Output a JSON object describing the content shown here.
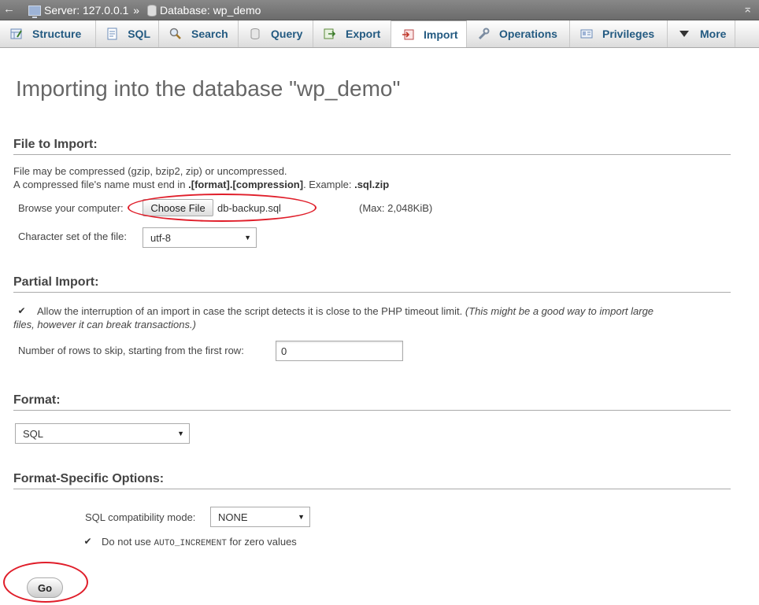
{
  "breadcrumb": {
    "back_glyph": "←",
    "server": "Server: 127.0.0.1",
    "sep": "»",
    "database": "Database: wp_demo",
    "collapse_glyph": "⌅"
  },
  "tabs": [
    {
      "label": "Structure",
      "icon": "structure-icon"
    },
    {
      "label": "SQL",
      "icon": "sql-icon"
    },
    {
      "label": "Search",
      "icon": "search-icon"
    },
    {
      "label": "Query",
      "icon": "query-icon"
    },
    {
      "label": "Export",
      "icon": "export-icon"
    },
    {
      "label": "Import",
      "icon": "import-icon",
      "active": true
    },
    {
      "label": "Operations",
      "icon": "wrench-icon"
    },
    {
      "label": "Privileges",
      "icon": "privileges-icon"
    },
    {
      "label": "More",
      "icon": "chevron-down-icon"
    }
  ],
  "page": {
    "title": "Importing into the database \"wp_demo\""
  },
  "file_import": {
    "heading": "File to Import:",
    "line1": "File may be compressed (gzip, bzip2, zip) or uncompressed.",
    "line2_pre": "A compressed file's name must end in ",
    "line2_format": ".[format].[compression]",
    "line2_mid": ". Example: ",
    "line2_example": ".sql.zip",
    "browse_label": "Browse your computer:",
    "choose_button": "Choose File",
    "file_name": "db-backup.sql",
    "max_size": "(Max: 2,048KiB)",
    "charset_label": "Character set of the file:",
    "charset_value": "utf-8"
  },
  "partial_import": {
    "heading": "Partial Import:",
    "allow_checked": true,
    "allow_text": "Allow the interruption of an import in case the script detects it is close to the PHP timeout limit.",
    "allow_note_1": "(This might be a good way to import large",
    "allow_note_2": "files, however it can break transactions.)",
    "skip_label": "Number of rows to skip, starting from the first row:",
    "skip_value": "0"
  },
  "format": {
    "heading": "Format:",
    "value": "SQL"
  },
  "format_options": {
    "heading": "Format-Specific Options:",
    "compat_label": "SQL compatibility mode:",
    "compat_value": "NONE",
    "auto_inc_checked": true,
    "auto_inc_pre": "Do not use ",
    "auto_inc_code": "AUTO_INCREMENT",
    "auto_inc_post": " for zero values"
  },
  "go_button": "Go",
  "annotation_color": "#e01e2a",
  "link_color": "#235a81"
}
